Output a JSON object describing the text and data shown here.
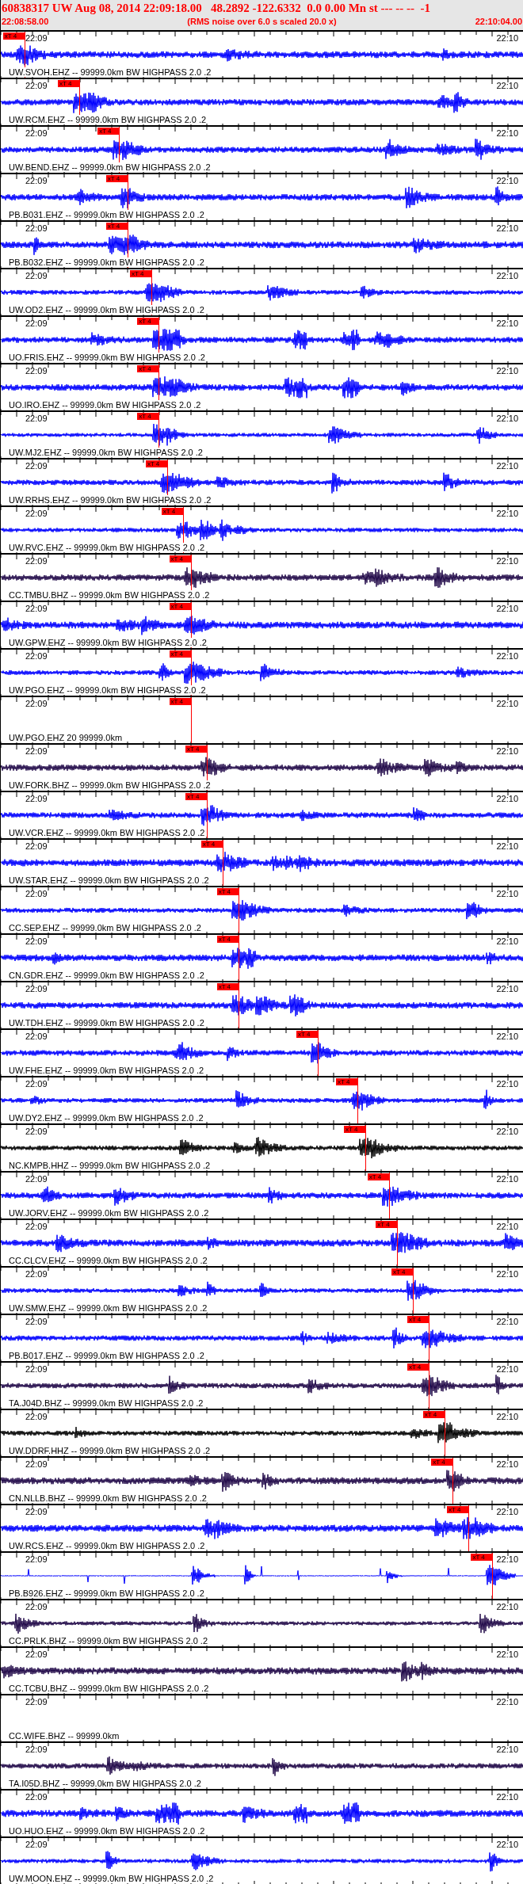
{
  "header": {
    "title": "60838317 UW Aug 08, 2014 22:09:18.00   48.2892 -122.6332  0.0 0.00 Mn st --- -- --  -1",
    "start_time": "22:08:58.00",
    "note": "(RMS noise over 6.0 s scaled 20.0 x)",
    "end_time": "22:10:04.00"
  },
  "traces": [
    {
      "kind": "waveform",
      "color": "#0000ff",
      "label": "UW.SVOH.EHZ -- 99999.0km BW HIGHPASS 2.0 .2",
      "start_tick": "22:09",
      "end_tick": "22:10",
      "pick": {
        "label": "xT 4",
        "level": 0.045
      }
    },
    {
      "kind": "waveform",
      "color": "#0000ff",
      "label": "UW.RCM.EHZ -- 99999.0km BW HIGHPASS 2.0 .2",
      "start_tick": "22:09",
      "end_tick": "22:10",
      "pick": {
        "label": "xT 4",
        "level": 0.15
      }
    },
    {
      "kind": "waveform",
      "color": "#0000ff",
      "label": "UW.BEND.EHZ -- 99999.0km BW HIGHPASS 2.0 .2",
      "start_tick": "22:09",
      "end_tick": "22:10",
      "pick": {
        "label": "xT 4",
        "level": 0.226
      }
    },
    {
      "kind": "waveform",
      "color": "#0000ff",
      "label": "PB.B031.EHZ -- 99999.0km BW HIGHPASS 2.0 .2",
      "start_tick": "22:09",
      "end_tick": "22:10",
      "pick": {
        "label": "xT 4",
        "level": 0.242
      }
    },
    {
      "kind": "waveform",
      "color": "#0000ff",
      "label": "PB.B032.EHZ -- 99999.0km BW HIGHPASS 2.0 .2",
      "start_tick": "22:09",
      "end_tick": "22:10",
      "pick": {
        "label": "xT 4",
        "level": 0.242
      }
    },
    {
      "kind": "waveform",
      "color": "#0000ff",
      "label": "UW.OD2.EHZ -- 99999.0km BW HIGHPASS 2.0 .2",
      "start_tick": "22:09",
      "end_tick": "22:10",
      "pick": {
        "label": "xT 4",
        "level": 0.288
      }
    },
    {
      "kind": "clipped",
      "color": "#0000ff",
      "label": "UO.FRIS.EHZ -- 99999.0km BW HIGHPASS 2.0 .2",
      "start_tick": "22:09",
      "end_tick": "22:10",
      "pick": {
        "label": "xT 4",
        "level": 0.302
      }
    },
    {
      "kind": "clipped",
      "color": "#0000ff",
      "label": "UO.IRO.EHZ -- 99999.0km BW HIGHPASS 2.0 .2",
      "start_tick": "22:09",
      "end_tick": "22:10",
      "pick": {
        "label": "xT 4",
        "level": 0.302
      }
    },
    {
      "kind": "waveform",
      "color": "#0000ff",
      "label": "UW.MJ2.EHZ -- 99999.0km BW HIGHPASS 2.0 .2",
      "start_tick": "22:09",
      "end_tick": "22:10",
      "pick": {
        "label": "xT 4",
        "level": 0.302
      }
    },
    {
      "kind": "waveform",
      "color": "#0000ff",
      "label": "UW.RRHS.EHZ -- 99999.0km BW HIGHPASS 2.0 .2",
      "start_tick": "22:09",
      "end_tick": "22:10",
      "pick": {
        "label": "xT 4",
        "level": 0.318
      }
    },
    {
      "kind": "waveform",
      "color": "#0000ff",
      "label": "UW.RVC.EHZ -- 99999.0km BW HIGHPASS 2.0 .2",
      "start_tick": "22:09",
      "end_tick": "22:10",
      "pick": {
        "label": "xT 4",
        "level": 0.348
      }
    },
    {
      "kind": "waveform",
      "color": "#200848",
      "label": "CC.TMBU.BHZ -- 99999.0km BW HIGHPASS 2.0 .2",
      "start_tick": "22:09",
      "end_tick": "22:10",
      "pick": {
        "label": "xT 4",
        "level": 0.363
      }
    },
    {
      "kind": "waveform",
      "color": "#0000ff",
      "label": "UW.GPW.EHZ -- 99999.0km BW HIGHPASS 2.0 .2",
      "start_tick": "22:09",
      "end_tick": "22:10",
      "pick": {
        "label": "xT 4",
        "level": 0.363
      }
    },
    {
      "kind": "waveform",
      "color": "#0000ff",
      "label": "UW.PGO.EHZ -- 99999.0km BW HIGHPASS 2.0 .2",
      "start_tick": "22:09",
      "end_tick": "22:10",
      "pick": {
        "label": "xT 4",
        "level": 0.363
      }
    },
    {
      "kind": "empty",
      "label": "UW.PGO.EHZ 20 99999.0km",
      "start_tick": "22:09",
      "end_tick": "22:10",
      "pick": {
        "label": "xT 4",
        "level": 0.363
      }
    },
    {
      "kind": "waveform",
      "color": "#200848",
      "label": "UW.FORK.BHZ -- 99999.0km BW HIGHPASS 2.0 .2",
      "start_tick": "22:09",
      "end_tick": "22:10",
      "pick": {
        "label": "xT 4",
        "level": 0.394
      }
    },
    {
      "kind": "waveform",
      "color": "#0000ff",
      "label": "UW.VCR.EHZ -- 99999.0km BW HIGHPASS 2.0 .2",
      "start_tick": "22:09",
      "end_tick": "22:10",
      "pick": {
        "label": "xT 4",
        "level": 0.394
      }
    },
    {
      "kind": "waveform",
      "color": "#0000ff",
      "label": "UW.STAR.EHZ -- 99999.0km BW HIGHPASS 2.0 .2",
      "start_tick": "22:09",
      "end_tick": "22:10",
      "pick": {
        "label": "xT 4",
        "level": 0.424
      }
    },
    {
      "kind": "waveform",
      "color": "#0000ff",
      "label": "CC.SEP.EHZ -- 99999.0km BW HIGHPASS 2.0 .2",
      "start_tick": "22:09",
      "end_tick": "22:10",
      "pick": {
        "label": "xT 4",
        "level": 0.454
      }
    },
    {
      "kind": "waveform",
      "color": "#0000ff",
      "label": "CN.GDR.EHZ -- 99999.0km BW HIGHPASS 2.0 .2",
      "start_tick": "22:09",
      "end_tick": "22:10",
      "pick": {
        "label": "xT 4",
        "level": 0.454
      }
    },
    {
      "kind": "waveform",
      "color": "#0000ff",
      "label": "UW.TDH.EHZ -- 99999.0km BW HIGHPASS 2.0 .2",
      "start_tick": "22:09",
      "end_tick": "22:10",
      "pick": {
        "label": "xT 4",
        "level": 0.454
      }
    },
    {
      "kind": "waveform",
      "color": "#0000ff",
      "label": "UW.FHE.EHZ -- 99999.0km BW HIGHPASS 2.0 .2",
      "start_tick": "22:09",
      "end_tick": "22:10",
      "pick": {
        "label": "xT 4",
        "level": 0.606
      }
    },
    {
      "kind": "waveform",
      "color": "#0000ff",
      "label": "UW.DY2.EHZ -- 99999.0km BW HIGHPASS 2.0 .2",
      "start_tick": "22:09",
      "end_tick": "22:10",
      "pick": {
        "label": "xT 4",
        "level": 0.682
      }
    },
    {
      "kind": "waveform",
      "color": "#000000",
      "label": "NC.KMPB.HHZ -- 99999.0km BW HIGHPASS 2.0 .2",
      "start_tick": "22:09",
      "end_tick": "22:10",
      "pick": {
        "label": "xT 4",
        "level": 0.697
      }
    },
    {
      "kind": "waveform",
      "color": "#0000ff",
      "label": "UW.JORV.EHZ -- 99999.0km BW HIGHPASS 2.0 .2",
      "start_tick": "22:09",
      "end_tick": "22:10",
      "pick": {
        "label": "xT 4",
        "level": 0.742
      }
    },
    {
      "kind": "waveform",
      "color": "#0000ff",
      "label": "CC.CLCV.EHZ -- 99999.0km BW HIGHPASS 2.0 .2",
      "start_tick": "22:09",
      "end_tick": "22:10",
      "pick": {
        "label": "xT 4",
        "level": 0.758
      }
    },
    {
      "kind": "waveform",
      "color": "#0000ff",
      "label": "UW.SMW.EHZ -- 99999.0km BW HIGHPASS 2.0 .2",
      "start_tick": "22:09",
      "end_tick": "22:10",
      "pick": {
        "label": "xT 4",
        "level": 0.788
      }
    },
    {
      "kind": "waveform",
      "color": "#0000ff",
      "label": "PB.B017.EHZ -- 99999.0km BW HIGHPASS 2.0 .2",
      "start_tick": "22:09",
      "end_tick": "22:10",
      "pick": {
        "label": "xT 4",
        "level": 0.818
      }
    },
    {
      "kind": "waveform",
      "color": "#200848",
      "label": "TA.J04D.BHZ -- 99999.0km BW HIGHPASS 2.0 .2",
      "start_tick": "22:09",
      "end_tick": "22:10",
      "pick": {
        "label": "xT 4",
        "level": 0.818
      }
    },
    {
      "kind": "waveform",
      "color": "#000000",
      "label": "UW.DDRF.HHZ -- 99999.0km BW HIGHPASS 2.0 .2",
      "start_tick": "22:09",
      "end_tick": "22:10",
      "pick": {
        "label": "xT 4",
        "level": 0.848
      }
    },
    {
      "kind": "waveform",
      "color": "#200848",
      "label": "CN.NLLB.BHZ -- 99999.0km BW HIGHPASS 2.0 .2",
      "start_tick": "22:09",
      "end_tick": "22:10",
      "pick": {
        "label": "xT 4",
        "level": 0.864
      }
    },
    {
      "kind": "waveform",
      "color": "#0000ff",
      "label": "UW.RCS.EHZ -- 99999.0km BW HIGHPASS 2.0 .2",
      "start_tick": "22:09",
      "end_tick": "22:10",
      "pick": {
        "label": "xT 4",
        "level": 0.894
      }
    },
    {
      "kind": "spiky",
      "color": "#0000ff",
      "label": "PB.B926.EHZ -- 99999.0km BW HIGHPASS 2.0 .2",
      "start_tick": "22:09",
      "end_tick": "22:10",
      "pick": {
        "label": "xT 4",
        "level": 0.94
      }
    },
    {
      "kind": "waveform",
      "color": "#200848",
      "label": "CC.PRLK.BHZ -- 99999.0km BW HIGHPASS 2.0 .2",
      "start_tick": "22:09",
      "end_tick": "22:10"
    },
    {
      "kind": "waveform",
      "color": "#200848",
      "label": "CC.TCBU.BHZ -- 99999.0km BW HIGHPASS 2.0 .2",
      "start_tick": "22:09",
      "end_tick": "22:10"
    },
    {
      "kind": "empty",
      "label": "CC.WIFE.BHZ -- 99999.0km",
      "start_tick": "22:09",
      "end_tick": "22:10"
    },
    {
      "kind": "waveform",
      "color": "#200848",
      "label": "TA.I05D.BHZ -- 99999.0km BW HIGHPASS 2.0 .2",
      "start_tick": "22:09",
      "end_tick": "22:10"
    },
    {
      "kind": "clipped",
      "color": "#0000ff",
      "label": "UO.HUO.EHZ -- 99999.0km BW HIGHPASS 2.0 .2",
      "start_tick": "22:09",
      "end_tick": "22:10"
    },
    {
      "kind": "waveform",
      "color": "#0000ff",
      "label": "UW.MOON.EHZ -- 99999.0km BW HIGHPASS 2.0 .2",
      "start_tick": "22:09",
      "end_tick": "22:10"
    }
  ]
}
